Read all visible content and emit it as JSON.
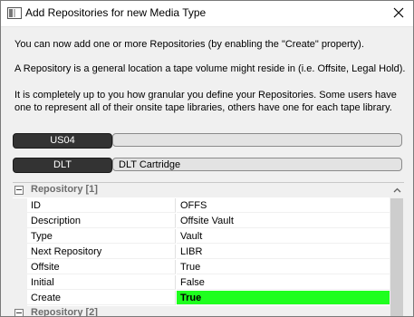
{
  "window": {
    "title": "Add Repositories for new Media Type"
  },
  "info": {
    "line1": "You can now add one or more Repositories (by enabling the \"Create\" property).",
    "line2": "A Repository is a general location a tape volume might reside in (i.e. Offsite, Legal Hold).",
    "line3a": "It is completely up to you how granular you define your Repositories. Some users have",
    "line3b": "one to represent all of their onsite tape libraries, others have one for each tape library."
  },
  "library": {
    "label": "US04",
    "value": ""
  },
  "media_type": {
    "label": "DLT",
    "value": "DLT Cartridge"
  },
  "grid": {
    "category1": "Repository [1]",
    "category2": "Repository [2]",
    "rows": [
      {
        "name": "ID",
        "value": "OFFS"
      },
      {
        "name": "Description",
        "value": "Offsite Vault"
      },
      {
        "name": "Type",
        "value": "Vault"
      },
      {
        "name": "Next Repository",
        "value": "LIBR"
      },
      {
        "name": "Offsite",
        "value": "True"
      },
      {
        "name": "Initial",
        "value": "False"
      },
      {
        "name": "Create",
        "value": "True"
      }
    ],
    "highlight_color": "#1eff1e"
  },
  "icons": {
    "app": "app-window-icon",
    "close": "close-icon",
    "collapse": "collapse-minus-icon",
    "scroll_up": "chevron-up-icon"
  }
}
